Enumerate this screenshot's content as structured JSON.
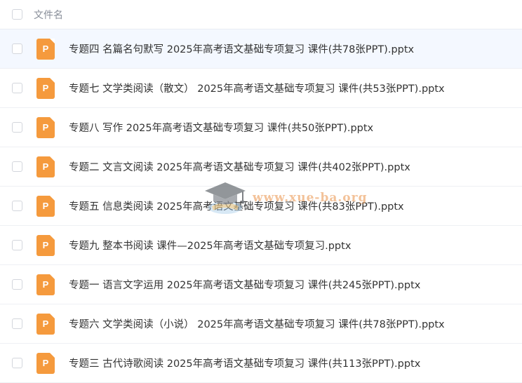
{
  "header": {
    "column_label": "文件名"
  },
  "files": [
    {
      "name": "专题四 名篇名句默写 2025年高考语文基础专项复习 课件(共78张PPT).pptx",
      "icon": "ppt-file-icon",
      "icon_letter": "P"
    },
    {
      "name": "专题七 文学类阅读（散文） 2025年高考语文基础专项复习 课件(共53张PPT).pptx",
      "icon": "ppt-file-icon",
      "icon_letter": "P"
    },
    {
      "name": "专题八 写作 2025年高考语文基础专项复习 课件(共50张PPT).pptx",
      "icon": "ppt-file-icon",
      "icon_letter": "P"
    },
    {
      "name": "专题二 文言文阅读 2025年高考语文基础专项复习 课件(共402张PPT).pptx",
      "icon": "ppt-file-icon",
      "icon_letter": "P"
    },
    {
      "name": "专题五 信息类阅读 2025年高考语文基础专项复习 课件(共83张PPT).pptx",
      "icon": "ppt-file-icon",
      "icon_letter": "P"
    },
    {
      "name": "专题九 整本书阅读 课件—2025年高考语文基础专项复习.pptx",
      "icon": "ppt-file-icon",
      "icon_letter": "P"
    },
    {
      "name": "专题一 语言文字运用 2025年高考语文基础专项复习 课件(共245张PPT).pptx",
      "icon": "ppt-file-icon",
      "icon_letter": "P"
    },
    {
      "name": "专题六 文学类阅读（小说） 2025年高考语文基础专项复习 课件(共78张PPT).pptx",
      "icon": "ppt-file-icon",
      "icon_letter": "P"
    },
    {
      "name": "专题三 古代诗歌阅读 2025年高考语文基础专项复习 课件(共113张PPT).pptx",
      "icon": "ppt-file-icon",
      "icon_letter": "P"
    }
  ],
  "watermark": {
    "text": "www.xue-ba.org",
    "icon": "graduation-cap-icon"
  },
  "colors": {
    "file_icon": "#f59a3d",
    "hover_row": "#f4f8ff",
    "watermark": "#e88a3c"
  }
}
